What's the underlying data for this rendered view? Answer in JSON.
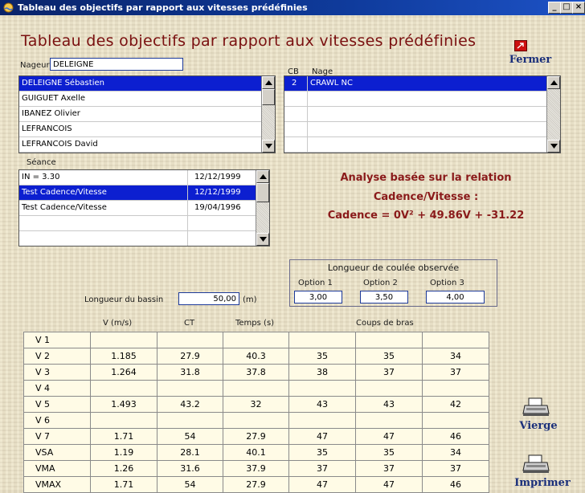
{
  "window": {
    "title": "Tableau des objectifs par rapport aux vitesses prédéfinies",
    "controls": [
      "_",
      "□",
      "×"
    ]
  },
  "header": {
    "title": "Tableau des objectifs par rapport aux vitesses prédéfinies",
    "close_label": "Fermer"
  },
  "swimmer": {
    "label": "Nageur",
    "value": "DELEIGNE",
    "list": [
      {
        "name": "DELEIGNE Sébastien",
        "selected": true
      },
      {
        "name": "GUIGUET Axelle",
        "selected": false
      },
      {
        "name": "IBANEZ Olivier",
        "selected": false
      },
      {
        "name": "LEFRANCOIS",
        "selected": false
      },
      {
        "name": "LEFRANCOIS David",
        "selected": false
      }
    ]
  },
  "nage": {
    "col_cb": "CB",
    "col_nage": "Nage",
    "rows": [
      {
        "cb": "2",
        "nage": "CRAWL NC",
        "selected": true
      },
      {
        "cb": "",
        "nage": "",
        "selected": false
      },
      {
        "cb": "",
        "nage": "",
        "selected": false
      },
      {
        "cb": "",
        "nage": "",
        "selected": false
      },
      {
        "cb": "",
        "nage": "",
        "selected": false
      }
    ]
  },
  "seance": {
    "label": "Séance",
    "rows": [
      {
        "name": "IN = 3.30",
        "date": "12/12/1999",
        "selected": false
      },
      {
        "name": "Test Cadence/Vitesse",
        "date": "12/12/1999",
        "selected": true
      },
      {
        "name": "Test Cadence/Vitesse",
        "date": "19/04/1996",
        "selected": false
      },
      {
        "name": "",
        "date": "",
        "selected": false
      },
      {
        "name": "",
        "date": "",
        "selected": false
      }
    ]
  },
  "analysis": {
    "line1": "Analyse basée sur la relation",
    "line2": "Cadence/Vitesse :",
    "line3": "Cadence = 0V² + 49.86V + -31.22"
  },
  "pool": {
    "label": "Longueur du bassin",
    "value": "50,00",
    "unit": "(m)"
  },
  "glide": {
    "title": "Longueur de coulée observée",
    "options": [
      {
        "label": "Option 1",
        "value": "3,00"
      },
      {
        "label": "Option 2",
        "value": "3,50"
      },
      {
        "label": "Option 3",
        "value": "4,00"
      }
    ]
  },
  "table": {
    "headers": {
      "v": "V (m/s)",
      "ct": "CT",
      "temps": "Temps (s)",
      "coups": "Coups de bras"
    },
    "rows": [
      [
        "V 1",
        "",
        "",
        "",
        "",
        "",
        ""
      ],
      [
        "V 2",
        "1.185",
        "27.9",
        "40.3",
        "35",
        "35",
        "34"
      ],
      [
        "V 3",
        "1.264",
        "31.8",
        "37.8",
        "38",
        "37",
        "37"
      ],
      [
        "V 4",
        "",
        "",
        "",
        "",
        "",
        ""
      ],
      [
        "V 5",
        "1.493",
        "43.2",
        "32",
        "43",
        "43",
        "42"
      ],
      [
        "V 6",
        "",
        "",
        "",
        "",
        "",
        ""
      ],
      [
        "V 7",
        "1.71",
        "54",
        "27.9",
        "47",
        "47",
        "46"
      ],
      [
        "VSA",
        "1.19",
        "28.1",
        "40.1",
        "35",
        "35",
        "34"
      ],
      [
        "VMA",
        "1.26",
        "31.6",
        "37.9",
        "37",
        "37",
        "37"
      ],
      [
        "VMAX",
        "1.71",
        "54",
        "27.9",
        "47",
        "47",
        "46"
      ]
    ]
  },
  "actions": {
    "blank_label": "Vierge",
    "print_label": "Imprimer"
  },
  "icons": {
    "app": "swimmer-icon",
    "close": "close-icon",
    "print": "printer-icon"
  },
  "colors": {
    "selection": "#0c1fd0",
    "title_text": "#7a1010",
    "analysis_text": "#8a1a1a",
    "titlebar": "#0a246a"
  }
}
